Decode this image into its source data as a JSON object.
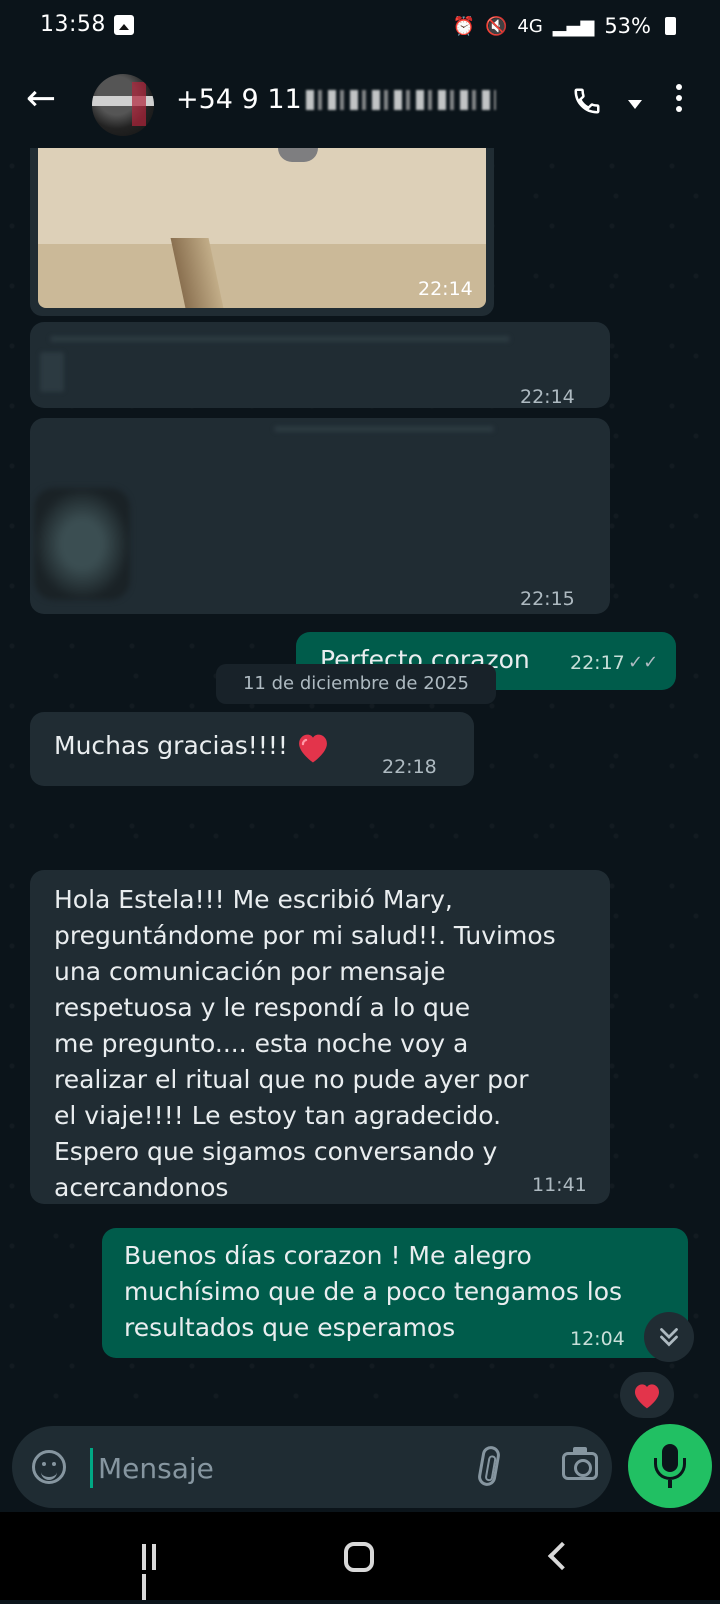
{
  "status_bar": {
    "time": "13:58",
    "network": "4G",
    "battery": "53%"
  },
  "header": {
    "contact_visible": "+54 9 11"
  },
  "messages": [
    {
      "type": "image",
      "direction": "in",
      "time": "22:14"
    },
    {
      "type": "redacted",
      "direction": "in",
      "time": "22:14"
    },
    {
      "type": "redacted",
      "direction": "in",
      "time": "22:15"
    },
    {
      "type": "text",
      "direction": "out",
      "text": "Perfecto corazon",
      "time": "22:17",
      "status": "read"
    },
    {
      "type": "text",
      "direction": "in",
      "text": "Muchas gracias!!!!",
      "emoji": "heart",
      "time": "22:18"
    },
    {
      "type": "date",
      "text": "11 de diciembre de 2025"
    },
    {
      "type": "text",
      "direction": "in",
      "text": "Hola Estela!!! Me escribió Mary,\npreguntándome por mi salud!!. Tuvimos\nuna comunicación por mensaje\nrespetuosa y le respondí a lo que\nme pregunto.... esta noche voy a\nrealizar el ritual que no pude ayer por\nel viaje!!!! Le estoy tan agradecido.\nEspero que sigamos conversando y\nacercandonos",
      "time": "11:41"
    },
    {
      "type": "text",
      "direction": "out",
      "text": "Buenos días corazon ! Me alegro\nmuchísimo que de a poco tengamos los\nresultados que esperamos",
      "time": "12:04",
      "reaction": "heart"
    }
  ],
  "composer": {
    "placeholder": "Mensaje"
  },
  "colors": {
    "background": "#0b141a",
    "incoming_bubble": "#202c33",
    "outgoing_bubble": "#005c4b",
    "accent": "#21c063"
  }
}
